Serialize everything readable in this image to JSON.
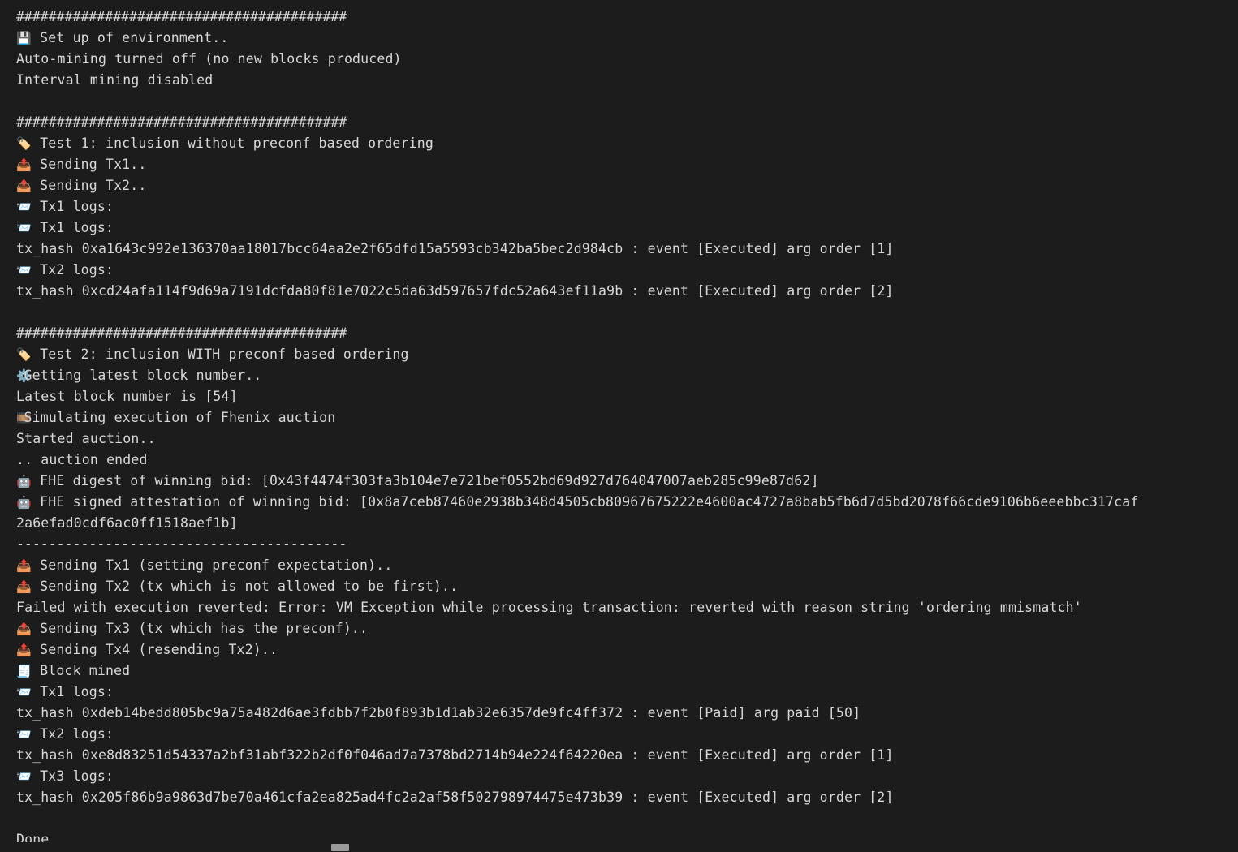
{
  "terminal": {
    "background_color": "#1c1c1c",
    "foreground_color": "#d8d8d8",
    "scrollbar": {
      "name": "horizontal-scrollbar",
      "thumb_color": "#9a9a9a"
    },
    "lines": [
      {
        "icon": "",
        "text": "#########################################"
      },
      {
        "icon": "💾",
        "text": " Set up of environment.."
      },
      {
        "icon": "",
        "text": "Auto-mining turned off (no new blocks produced)"
      },
      {
        "icon": "",
        "text": "Interval mining disabled"
      },
      {
        "icon": "",
        "text": ""
      },
      {
        "icon": "",
        "text": "#########################################"
      },
      {
        "icon": "🏷️",
        "text": " Test 1: inclusion without preconf based ordering"
      },
      {
        "icon": "📤",
        "text": " Sending Tx1.."
      },
      {
        "icon": "📤",
        "text": " Sending Tx2.."
      },
      {
        "icon": "📨",
        "text": " Tx1 logs:"
      },
      {
        "icon": "📨",
        "text": " Tx1 logs:"
      },
      {
        "icon": "",
        "text": "tx_hash 0xa1643c992e136370aa18017bcc64aa2e2f65dfd15a5593cb342ba5bec2d984cb : event [Executed] arg order [1]"
      },
      {
        "icon": "📨",
        "text": " Tx2 logs:"
      },
      {
        "icon": "",
        "text": "tx_hash 0xcd24afa114f9d69a7191dcfda80f81e7022c5da63d597657fdc52a643ef11a9b : event [Executed] arg order [2]"
      },
      {
        "icon": "",
        "text": ""
      },
      {
        "icon": "",
        "text": "#########################################"
      },
      {
        "icon": "🏷️",
        "text": " Test 2: inclusion WITH preconf based ordering"
      },
      {
        "icon": "⚙️",
        "text": "Getting latest block number.."
      },
      {
        "icon": "",
        "text": "Latest block number is [54]"
      },
      {
        "icon": "🎞️",
        "text": "Simulating execution of Fhenix auction"
      },
      {
        "icon": "",
        "text": "Started auction.."
      },
      {
        "icon": "",
        "text": ".. auction ended"
      },
      {
        "icon": "🤖",
        "text": " FHE digest of winning bid: [0x43f4474f303fa3b104e7e721bef0552bd69d927d764047007aeb285c99e87d62]"
      },
      {
        "icon": "🤖",
        "text": " FHE signed attestation of winning bid: [0x8a7ceb87460e2938b348d4505cb80967675222e4600ac4727a8bab5fb6d7d5bd2078f66cde9106b6eeebbc317caf"
      },
      {
        "icon": "",
        "text": "2a6efad0cdf6ac0ff1518aef1b]"
      },
      {
        "icon": "",
        "text": "-----------------------------------------"
      },
      {
        "icon": "📤",
        "text": " Sending Tx1 (setting preconf expectation).."
      },
      {
        "icon": "📤",
        "text": " Sending Tx2 (tx which is not allowed to be first).."
      },
      {
        "icon": "",
        "text": "Failed with execution reverted: Error: VM Exception while processing transaction: reverted with reason string 'ordering mmismatch'"
      },
      {
        "icon": "📤",
        "text": " Sending Tx3 (tx which has the preconf).."
      },
      {
        "icon": "📤",
        "text": " Sending Tx4 (resending Tx2).."
      },
      {
        "icon": "🧾",
        "text": " Block mined"
      },
      {
        "icon": "📨",
        "text": " Tx1 logs:"
      },
      {
        "icon": "",
        "text": "tx_hash 0xdeb14bedd805bc9a75a482d6ae3fdbb7f2b0f893b1d1ab32e6357de9fc4ff372 : event [Paid] arg paid [50]"
      },
      {
        "icon": "📨",
        "text": " Tx2 logs:"
      },
      {
        "icon": "",
        "text": "tx_hash 0xe8d83251d54337a2bf31abf322b2df0f046ad7a7378bd2714b94e224f64220ea : event [Executed] arg order [1]"
      },
      {
        "icon": "📨",
        "text": " Tx3 logs:"
      },
      {
        "icon": "",
        "text": "tx_hash 0x205f86b9a9863d7be70a461cfa2ea825ad4fc2a2af58f502798974475e473b39 : event [Executed] arg order [2]"
      },
      {
        "icon": "",
        "text": ""
      },
      {
        "icon": "",
        "text": "Done"
      }
    ]
  }
}
